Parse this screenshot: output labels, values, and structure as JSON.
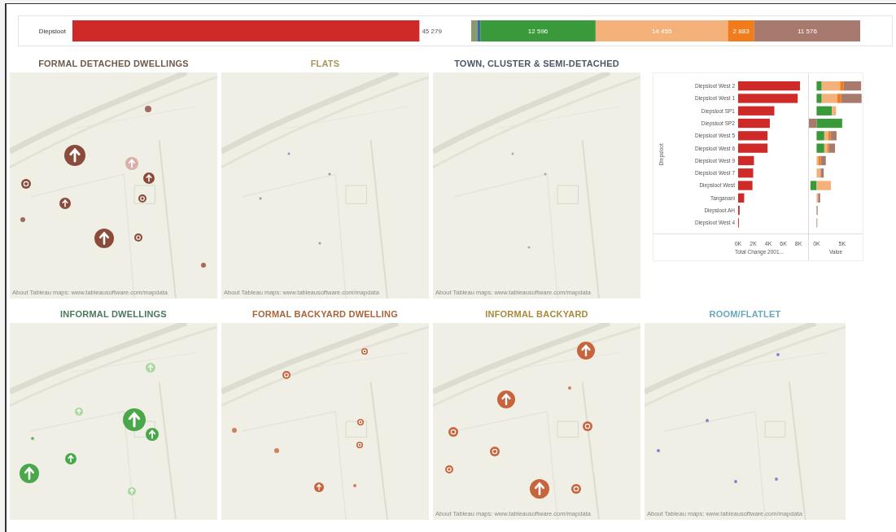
{
  "top_strip": {
    "total_chart": {
      "chart_data": {
        "type": "bar",
        "orientation": "horizontal",
        "categories": [
          "Diepsloot"
        ],
        "values": [
          45279
        ],
        "value_labels": [
          "45 279"
        ]
      }
    },
    "breakdown_chart": {
      "chart_data": {
        "type": "bar",
        "orientation": "horizontal",
        "stacked": true,
        "series": [
          {
            "color": "#8a9a6a",
            "values": [
              700
            ],
            "value_labels": [
              null
            ]
          },
          {
            "color": "#3a6aa8",
            "values": [
              300
            ],
            "value_labels": [
              null
            ]
          },
          {
            "color": "#3a9a3a",
            "values": [
              12596
            ],
            "value_labels": [
              "12 596"
            ]
          },
          {
            "color": "#f4b27a",
            "values": [
              14455
            ],
            "value_labels": [
              "14 455"
            ]
          },
          {
            "color": "#f07c1c",
            "values": [
              2883
            ],
            "value_labels": [
              "2 883"
            ]
          },
          {
            "color": "#a87a6e",
            "values": [
              11576
            ],
            "value_labels": [
              "11 576"
            ]
          }
        ]
      }
    }
  },
  "maps_top": [
    {
      "title": "FORMAL DETACHED DWELLINGS",
      "color": "#6e5a4a",
      "attribution": "About Tableau maps: www.tableausoftware.com/mapdata"
    },
    {
      "title": "FLATS",
      "color": "#a8965a",
      "attribution": "About Tableau maps: www.tableausoftware.com/mapdata"
    },
    {
      "title": "TOWN, CLUSTER & SEMI-DETACHED",
      "color": "#4a5866",
      "attribution": "About Tableau maps: www.tableausoftware.com/mapdata"
    }
  ],
  "side_panel": {
    "total_change_chart": {
      "chart_data": {
        "type": "bar",
        "orientation": "horizontal",
        "xlabel": "Total Change 2001...",
        "ylabel": "Diepsloot",
        "categories": [
          "Diepsloot West 2",
          "Diepsloot West 1",
          "Diepsloot SP1",
          "Diepsloot SP2",
          "Diepsloot West 5",
          "Diepsloot West 6",
          "Diepsloot West 9",
          "Diepsloot West 7",
          "Diepsloot West",
          "Tanganani",
          "Diepsloot AH",
          "Diepsloot West 4"
        ],
        "values": [
          8200,
          7900,
          4800,
          4200,
          3900,
          3900,
          2100,
          2000,
          1900,
          800,
          200,
          100
        ],
        "xlim": [
          0,
          8200
        ],
        "xticks": [
          {
            "value": 0,
            "label": "0K"
          },
          {
            "value": 2000,
            "label": "2K"
          },
          {
            "value": 4000,
            "label": "4K"
          },
          {
            "value": 6000,
            "label": "6K"
          },
          {
            "value": 8000,
            "label": "8K"
          }
        ]
      }
    },
    "value_chart": {
      "chart_data": {
        "type": "bar",
        "orientation": "horizontal",
        "stacked": true,
        "xlabel": "Value",
        "series": [
          {
            "color": "#3a9a3a",
            "values": [
              1000,
              1000,
              3000,
              5000,
              1500,
              1500,
              0,
              0,
              -1200,
              0,
              0,
              0
            ]
          },
          {
            "color": "#f4b27a",
            "values": [
              3600,
              3000,
              800,
              0,
              800,
              600,
              400,
              800,
              2800,
              300,
              0,
              0
            ]
          },
          {
            "color": "#f07c1c",
            "values": [
              700,
              800,
              0,
              0,
              400,
              300,
              400,
              0,
              0,
              0,
              0,
              0
            ]
          },
          {
            "color": "#a87a6e",
            "values": [
              3400,
              4000,
              0,
              -1500,
              1200,
              1200,
              1000,
              600,
              0,
              400,
              200,
              100
            ]
          }
        ],
        "xlim": [
          -1500,
          9000
        ],
        "xticks": [
          {
            "value": 0,
            "label": "0K"
          },
          {
            "value": 5000,
            "label": "5K"
          }
        ]
      }
    }
  },
  "maps_bottom": [
    {
      "title": "INFORMAL DWELLINGS",
      "color": "#4a7a5a"
    },
    {
      "title": "FORMAL BACKYARD DWELLING",
      "color": "#a8643a"
    },
    {
      "title": "INFORMAL BACKYARD",
      "color": "#a88a3a",
      "attribution": "About Tableau maps: www.tableausoftware.com/mapdata"
    },
    {
      "title": "ROOM/FLATLET",
      "color": "#6aa8bc",
      "attribution": "About Tableau maps: www.tableausoftware.com/mapdata"
    }
  ]
}
